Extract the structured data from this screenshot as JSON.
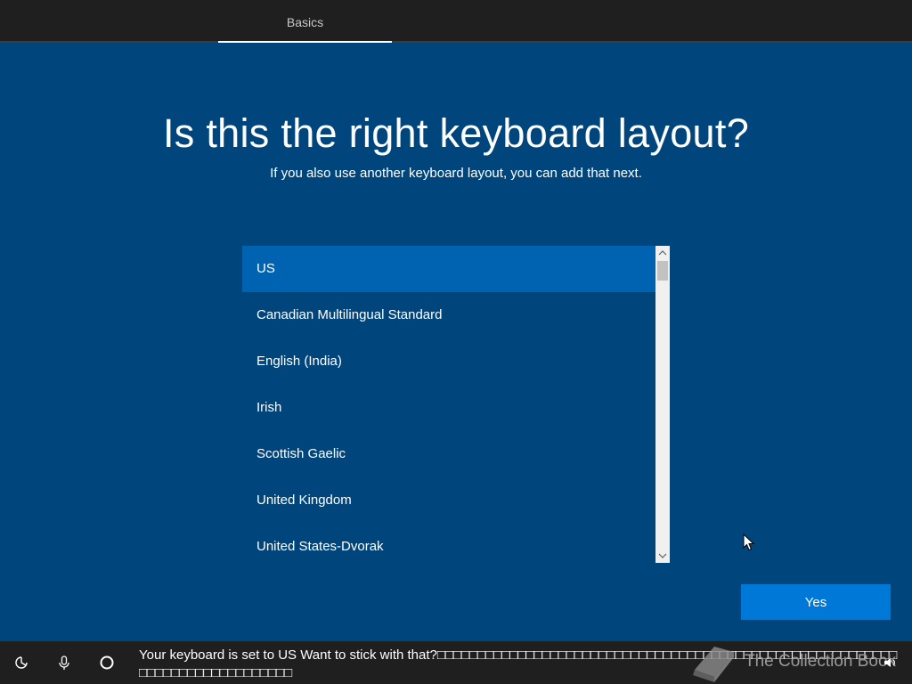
{
  "header": {
    "tab_label": "Basics"
  },
  "main": {
    "title": "Is this the right keyboard layout?",
    "subtitle": "If you also use another keyboard layout, you can add that next."
  },
  "layouts": {
    "items": [
      "US",
      "Canadian Multilingual Standard",
      "English (India)",
      "Irish",
      "Scottish Gaelic",
      "United Kingdom",
      "United States-Dvorak"
    ],
    "selected_index": 0
  },
  "actions": {
    "yes_label": "Yes"
  },
  "bottombar": {
    "caption": "Your keyboard is set to US Want to stick with that?□□□□□□□□□□□□□□□□□□□□□□□□□□□□□□□□□□□□□□□□□□□□□□□□□□□□□□□□□□□□□□□□□□□□□□□□□□□□",
    "watermark_text": "The Collection Book",
    "icons": [
      "ease-of-access-icon",
      "microphone-icon",
      "cortana-icon",
      "volume-icon"
    ]
  },
  "colors": {
    "background": "#00457c",
    "selected": "#0063b1",
    "button": "#0078d7",
    "bar": "#1f1f1f"
  }
}
